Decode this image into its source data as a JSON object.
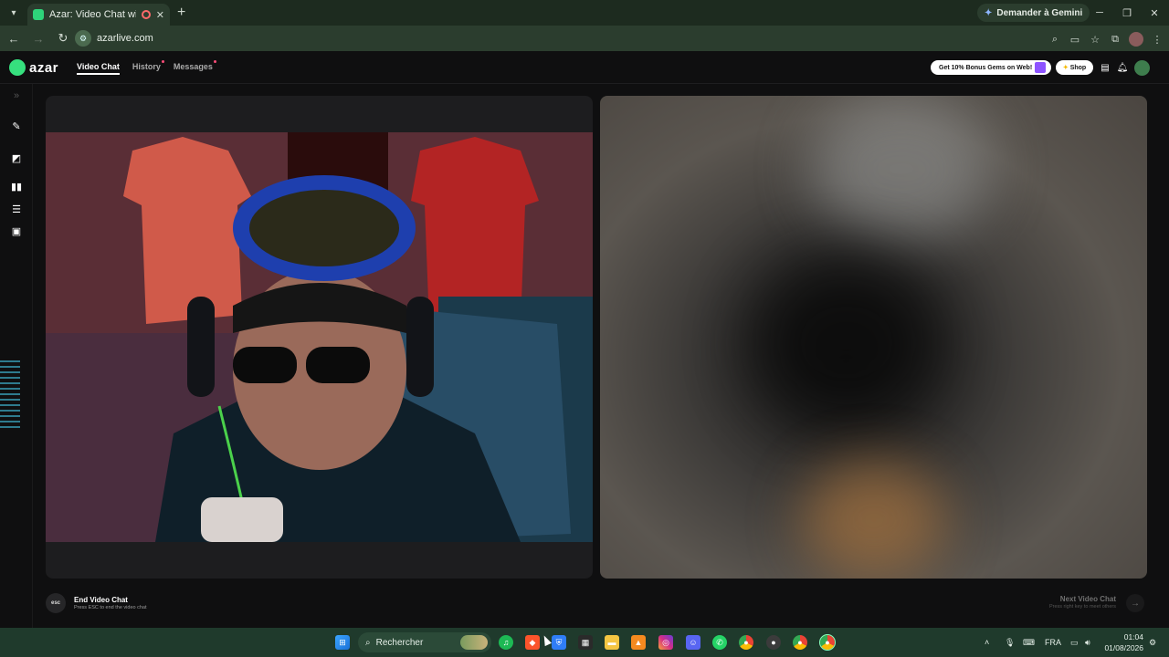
{
  "browser": {
    "tab_title": "Azar: Video Chat with New",
    "gemini_label": "Demander à Gemini",
    "url": "azarlive.com"
  },
  "app": {
    "logo": "azar",
    "nav": [
      "Video Chat",
      "History",
      "Messages"
    ],
    "promo": "Get 10% Bonus Gems on Web!",
    "shop": "Shop"
  },
  "chat": {
    "esc_badge": "esc",
    "end_title": "End Video Chat",
    "end_sub": "Press ESC to end the video chat",
    "next_title": "Next Video Chat",
    "next_sub": "Press right key to meet others"
  },
  "taskbar": {
    "search_placeholder": "Rechercher",
    "lang": "FRA",
    "time": "01:04",
    "date": "01/08/2026"
  },
  "colors": {
    "accent": "#36e07e",
    "taskbar": "#1f3a2c",
    "chrome": "#2b3d2e"
  }
}
